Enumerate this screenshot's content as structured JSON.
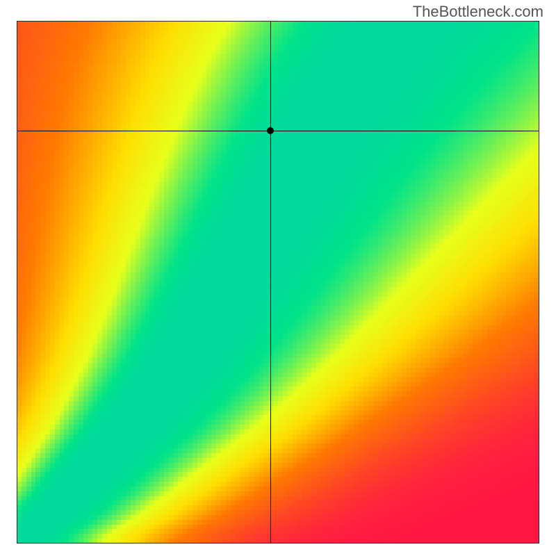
{
  "watermark": "TheBottleneck.com",
  "chart_data": {
    "type": "heatmap",
    "title": "",
    "xlabel": "",
    "ylabel": "",
    "xlim": [
      0,
      1
    ],
    "ylim": [
      0,
      1
    ],
    "grid_n": 110,
    "crosshair": {
      "x": 0.485,
      "y": 0.79
    },
    "point": {
      "x": 0.485,
      "y": 0.79
    },
    "color_stops": [
      {
        "t": 0.0,
        "color": "#ff1744"
      },
      {
        "t": 0.45,
        "color": "#ff7a00"
      },
      {
        "t": 0.68,
        "color": "#ffdd00"
      },
      {
        "t": 0.82,
        "color": "#e7ff1a"
      },
      {
        "t": 0.96,
        "color": "#00e38a"
      },
      {
        "t": 1.0,
        "color": "#00d99b"
      }
    ],
    "ridge": {
      "description": "approximate centerline of the green band in x-y (0..1) coordinates, origin bottom-left; band half-width in x",
      "points": [
        {
          "x": 0.01,
          "y": 0.01,
          "w": 0.02
        },
        {
          "x": 0.03,
          "y": 0.03,
          "w": 0.022
        },
        {
          "x": 0.06,
          "y": 0.055,
          "w": 0.024
        },
        {
          "x": 0.1,
          "y": 0.095,
          "w": 0.026
        },
        {
          "x": 0.15,
          "y": 0.15,
          "w": 0.03
        },
        {
          "x": 0.21,
          "y": 0.215,
          "w": 0.034
        },
        {
          "x": 0.27,
          "y": 0.29,
          "w": 0.038
        },
        {
          "x": 0.32,
          "y": 0.36,
          "w": 0.04
        },
        {
          "x": 0.37,
          "y": 0.44,
          "w": 0.042
        },
        {
          "x": 0.42,
          "y": 0.525,
          "w": 0.043
        },
        {
          "x": 0.47,
          "y": 0.61,
          "w": 0.045
        },
        {
          "x": 0.51,
          "y": 0.68,
          "w": 0.046
        },
        {
          "x": 0.56,
          "y": 0.76,
          "w": 0.048
        },
        {
          "x": 0.61,
          "y": 0.84,
          "w": 0.05
        },
        {
          "x": 0.66,
          "y": 0.915,
          "w": 0.052
        },
        {
          "x": 0.71,
          "y": 0.98,
          "w": 0.054
        },
        {
          "x": 0.74,
          "y": 1.02,
          "w": 0.054
        }
      ]
    }
  }
}
